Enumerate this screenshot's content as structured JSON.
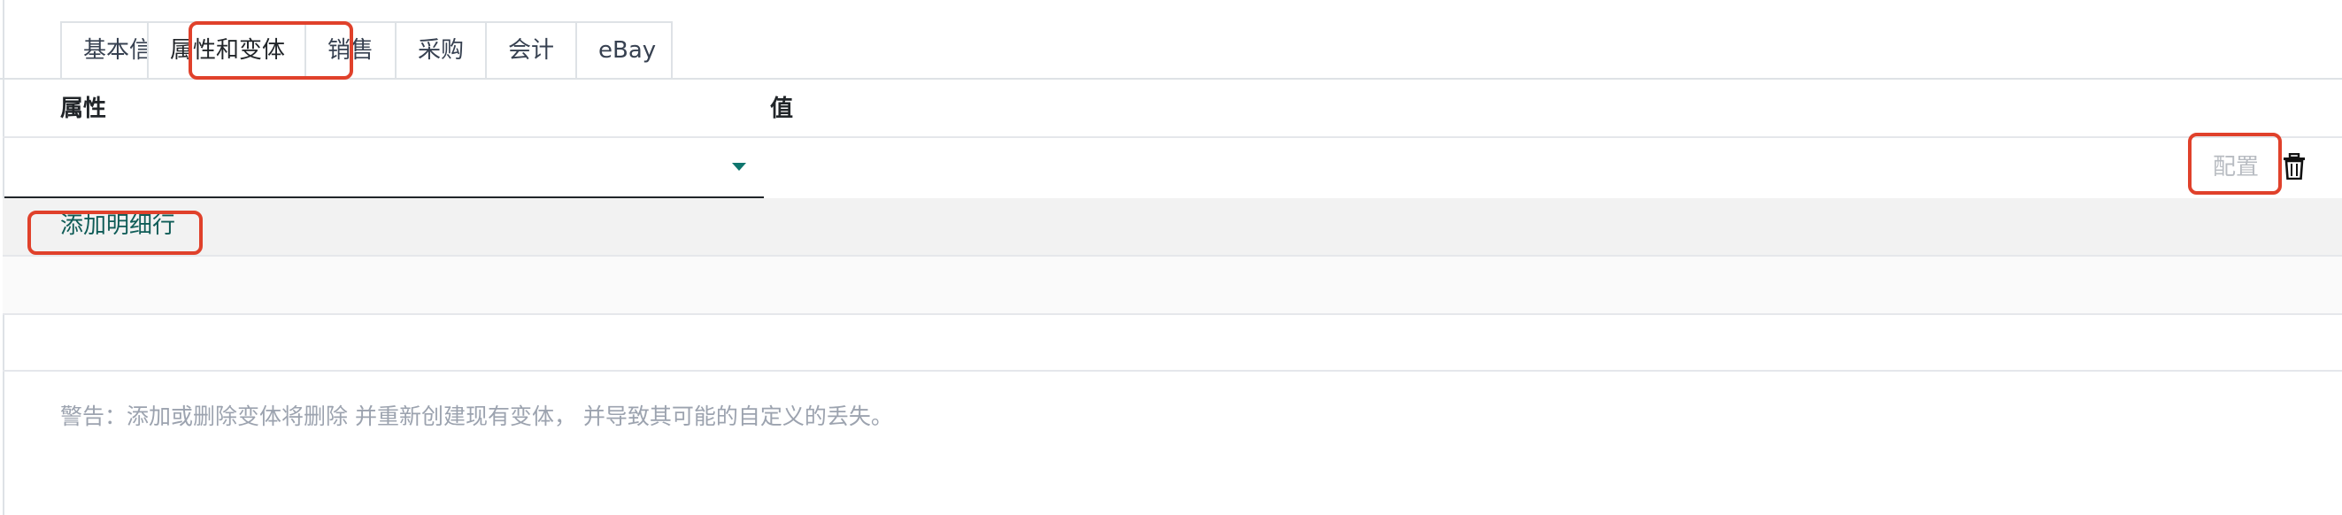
{
  "tabs": [
    {
      "label": "基本信息"
    },
    {
      "label": "属性和变体",
      "active": true
    },
    {
      "label": "销售"
    },
    {
      "label": "采购"
    },
    {
      "label": "会计"
    },
    {
      "label": "eBay"
    }
  ],
  "table": {
    "col_attribute": "属性",
    "col_value": "值",
    "row": {
      "attribute_value": "",
      "config_label": "配置",
      "delete_icon": "trash-icon"
    },
    "add_line_label": "添加明细行"
  },
  "warning_text": "警告：添加或删除变体将删除 并重新创建现有变体， 并导致其可能的自定义的丢失。",
  "colors": {
    "accent": "#0f766e",
    "highlight": "#e0412b",
    "muted": "#9ca3af"
  }
}
